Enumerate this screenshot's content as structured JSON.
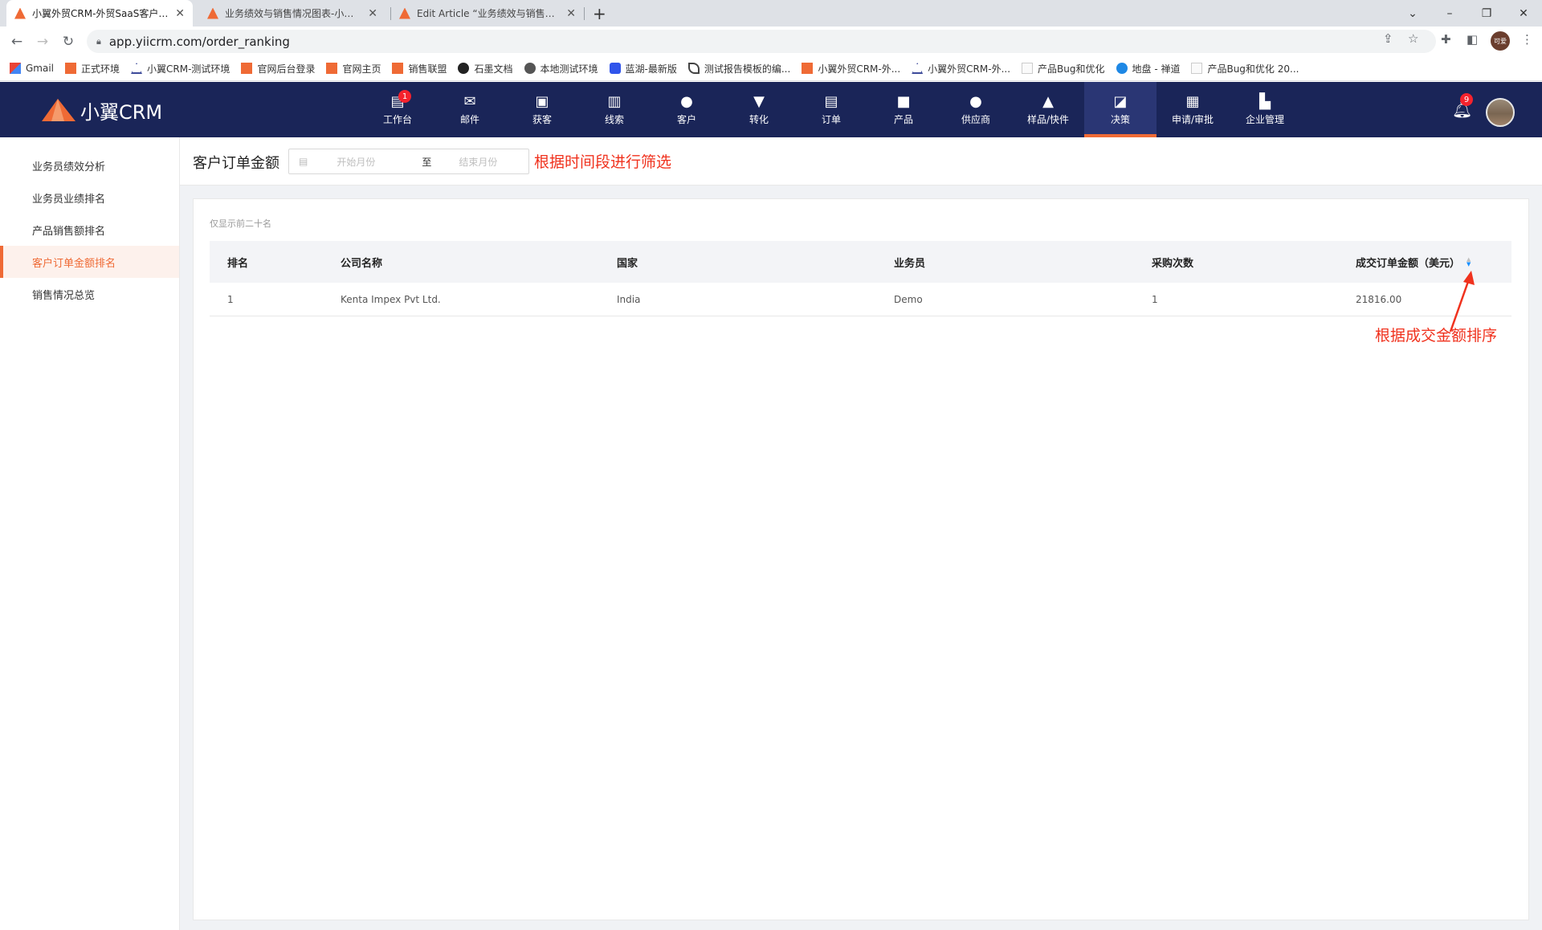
{
  "browser": {
    "tabs": [
      {
        "title": "小翼外贸CRM-外贸SaaS客户管理系统",
        "active": true
      },
      {
        "title": "业务绩效与销售情况图表-小翼外贸CRM",
        "active": false
      },
      {
        "title": "Edit Article “业务绩效与销售情况图表”",
        "active": false
      }
    ],
    "new_tab": "+",
    "url": "app.yiicrm.com/order_ranking",
    "bookmarks": [
      {
        "label": "Gmail",
        "icon": "gmail-icon"
      },
      {
        "label": "正式环境",
        "icon": "yiicrm-icon"
      },
      {
        "label": "小翼CRM-测试环境",
        "icon": "yiicrm-outline-icon"
      },
      {
        "label": "官网后台登录",
        "icon": "yiicrm-icon"
      },
      {
        "label": "官网主页",
        "icon": "yiicrm-icon"
      },
      {
        "label": "销售联盟",
        "icon": "yiicrm-icon"
      },
      {
        "label": "石墨文档",
        "icon": "shimo-icon"
      },
      {
        "label": "本地测试环境",
        "icon": "globe-icon"
      },
      {
        "label": "蓝湖-最新版",
        "icon": "lanhu-icon"
      },
      {
        "label": "测试报告模板的编...",
        "icon": "feather-icon"
      },
      {
        "label": "小翼外贸CRM-外...",
        "icon": "yiicrm-icon"
      },
      {
        "label": "小翼外贸CRM-外...",
        "icon": "yiicrm-outline-icon"
      },
      {
        "label": "产品Bug和优化",
        "icon": "doc-icon"
      },
      {
        "label": "地盘 - 禅道",
        "icon": "zentao-icon"
      },
      {
        "label": "产品Bug和优化 20...",
        "icon": "doc-icon"
      }
    ],
    "profile_text": "可爱"
  },
  "app": {
    "logo_text": "小翼CRM",
    "nav": [
      {
        "label": "工作台",
        "icon": "workbench-icon",
        "glyph": "▤",
        "badge": "1"
      },
      {
        "label": "邮件",
        "icon": "mail-icon",
        "glyph": "✉"
      },
      {
        "label": "获客",
        "icon": "acquire-icon",
        "glyph": "▣"
      },
      {
        "label": "线索",
        "icon": "leads-icon",
        "glyph": "▥"
      },
      {
        "label": "客户",
        "icon": "customer-icon",
        "glyph": "●"
      },
      {
        "label": "转化",
        "icon": "funnel-icon",
        "glyph": "▼"
      },
      {
        "label": "订单",
        "icon": "order-icon",
        "glyph": "▤"
      },
      {
        "label": "产品",
        "icon": "product-icon",
        "glyph": "■"
      },
      {
        "label": "供应商",
        "icon": "supplier-icon",
        "glyph": "●"
      },
      {
        "label": "样品/快件",
        "icon": "flask-icon",
        "glyph": "▲"
      },
      {
        "label": "决策",
        "icon": "chart-icon",
        "glyph": "◪",
        "active": true
      },
      {
        "label": "申请/审批",
        "icon": "approval-icon",
        "glyph": "▦"
      },
      {
        "label": "企业管理",
        "icon": "building-icon",
        "glyph": "▙"
      }
    ],
    "notification_count": "9"
  },
  "sidebar": {
    "items": [
      {
        "label": "业务员绩效分析"
      },
      {
        "label": "业务员业绩排名"
      },
      {
        "label": "产品销售额排名"
      },
      {
        "label": "客户订单金额排名",
        "active": true
      },
      {
        "label": "销售情况总览"
      }
    ]
  },
  "filter": {
    "title": "客户订单金额",
    "start_placeholder": "开始月份",
    "separator": "至",
    "end_placeholder": "结束月份",
    "annotation": "根据时间段进行筛选"
  },
  "table": {
    "note": "仅显示前二十名",
    "headers": {
      "rank": "排名",
      "company": "公司名称",
      "country": "国家",
      "salesperson": "业务员",
      "purchases": "采购次数",
      "amount": "成交订单金额（美元）"
    },
    "rows": [
      {
        "rank": "1",
        "company": "Kenta Impex Pvt Ltd.",
        "country": "India",
        "salesperson": "Demo",
        "purchases": "1",
        "amount": "21816.00"
      }
    ],
    "sort_annotation": "根据成交金额排序"
  },
  "colors": {
    "header_bg": "#1a2558",
    "accent": "#ef6a35",
    "annotation": "#f0321e",
    "sort_active": "#1890ff"
  }
}
